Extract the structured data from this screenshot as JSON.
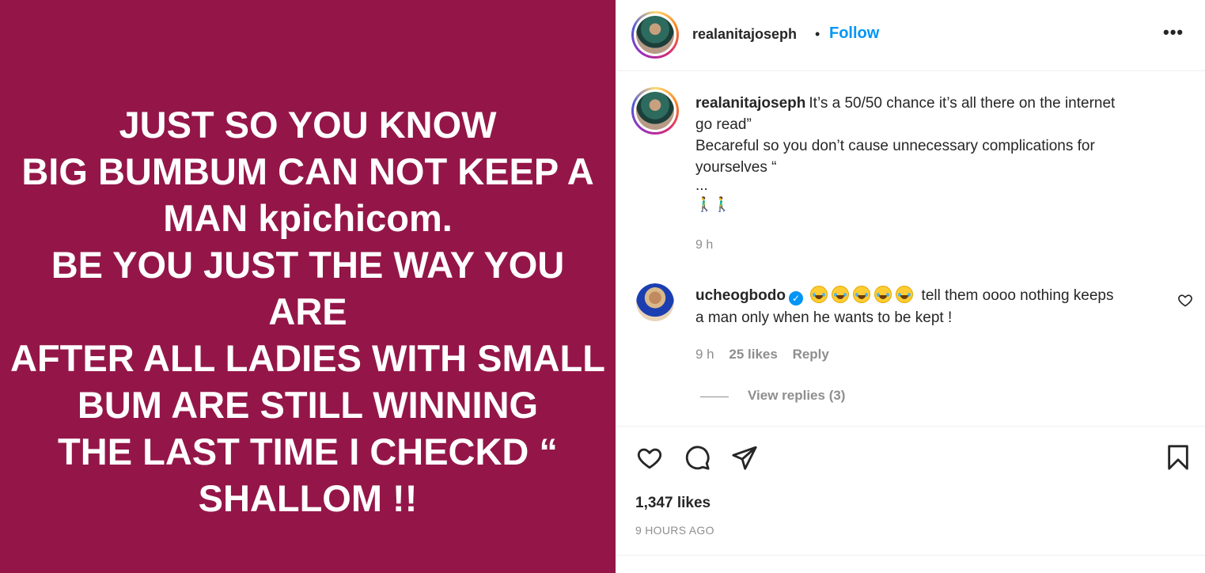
{
  "media": {
    "background": "#941648",
    "lines": [
      "JUST SO YOU KNOW",
      "BIG BUMBUM CAN NOT KEEP A",
      "MAN kpichicom.",
      "BE YOU JUST THE WAY YOU",
      "ARE",
      "AFTER ALL LADIES WITH SMALL",
      "BUM ARE STILL WINNING",
      "THE LAST TIME I CHECKD “",
      "SHALLOM !!"
    ]
  },
  "header": {
    "username": "realanitajoseph",
    "separator": "•",
    "follow_label": "Follow",
    "more_label": "•••"
  },
  "caption": {
    "username": "realanitajoseph",
    "lines": [
      "It’s a 50/50 chance it’s all there on the internet",
      "go read”",
      "Becareful so you don’t cause unnecessary complications for",
      "yourselves “",
      "...",
      "🚶‍♂️🚶‍♂️"
    ],
    "time": "9 h"
  },
  "comment": {
    "username": "ucheogbodo",
    "verified_icon": "verified-badge-icon",
    "emoji_count": 5,
    "text_first": "tell them oooo nothing keeps",
    "text_second": "a man only when he wants to be kept !",
    "time": "9 h",
    "likes": "25 likes",
    "reply_label": "Reply",
    "view_replies": "View replies (3)"
  },
  "actions": {
    "icons": [
      "heart-icon",
      "comment-icon",
      "share-icon",
      "bookmark-icon"
    ],
    "likes_count": "1,347 likes",
    "posted": "9 HOURS AGO"
  },
  "colors": {
    "accent": "#0095f6",
    "muted": "#8e8e8e",
    "text": "#262626"
  }
}
